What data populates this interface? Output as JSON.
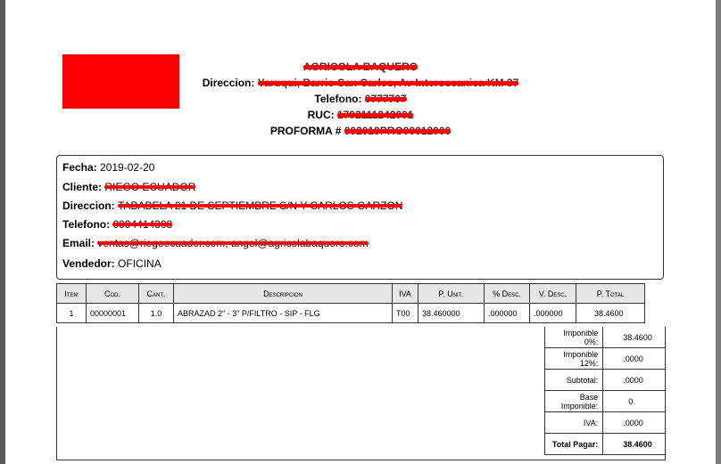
{
  "company": {
    "name": "AGRICOLA BAQUERO",
    "address_label": "Direccion:",
    "address": "Yaruqui, Barrio San Carlos, Av Interoceanica KM 37",
    "phone_label": "Telefono:",
    "phone": "0777707",
    "ruc_label": "RUC:",
    "ruc": "1792111242001",
    "proforma_label": "PROFORMA #",
    "proforma": "002019PRO00012000"
  },
  "customer": {
    "fecha_label": "Fecha:",
    "fecha": "2019-02-20",
    "cliente_label": "Cliente:",
    "cliente": "RIEGO ECUADOR",
    "direccion_label": "Direccion:",
    "direccion": "TABABELA 21 DE SEPTIEMBRE S/N Y CARLOS GARZON",
    "telefono_label": "Telefono:",
    "telefono": "0994414308",
    "email_label": "Email:",
    "email": "ventas@riegoecuador.com, angel@agricolabaquero.com",
    "vendedor_label": "Vendedor:",
    "vendedor": "OFICINA"
  },
  "items_table": {
    "headers": [
      "Item",
      "Cod.",
      "Cant.",
      "Descripcion",
      "IVA",
      "P. Unit.",
      "% Desc.",
      "V. Desc.",
      "P. Total"
    ],
    "rows": [
      [
        "1",
        "00000001",
        "1.0",
        "ABRAZAD 2\" - 3\" P/FILTRO - SIP - FLG",
        "T00",
        "38.460000",
        ".000000",
        ".000000",
        "38.4600"
      ]
    ]
  },
  "totals": [
    {
      "label": "Imponible 0%:",
      "value": "38.4600"
    },
    {
      "label": "Imponible 12%:",
      "value": ".0000"
    },
    {
      "label": "Subtotal:",
      "value": ".0000"
    },
    {
      "label": "Base Imponible:",
      "value": "0"
    },
    {
      "label": "IVA:",
      "value": ".0000"
    },
    {
      "label": "Total Pagar:",
      "value": "38.4600"
    }
  ],
  "colors": {
    "redaction": "#ff0000",
    "header_bg": "#e6e6e6"
  }
}
